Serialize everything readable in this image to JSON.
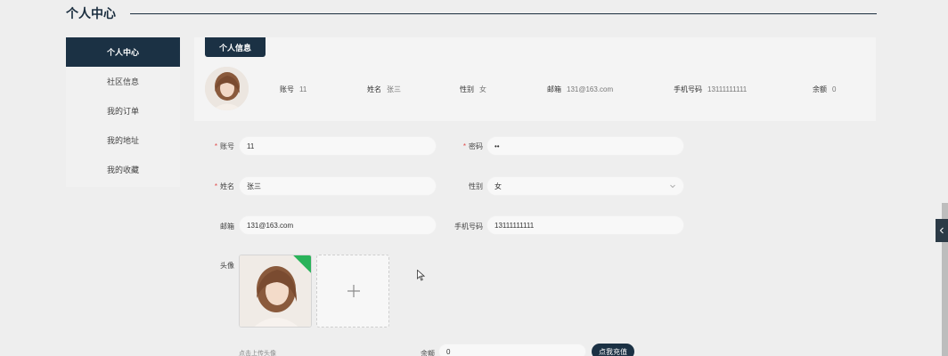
{
  "header": {
    "title": "个人中心"
  },
  "sidebar": {
    "items": [
      {
        "label": "个人中心"
      },
      {
        "label": "社区信息"
      },
      {
        "label": "我的订单"
      },
      {
        "label": "我的地址"
      },
      {
        "label": "我的收藏"
      }
    ]
  },
  "info_card": {
    "tab_label": "个人信息",
    "fields": [
      {
        "label": "账号",
        "value": "11"
      },
      {
        "label": "姓名",
        "value": "张三"
      },
      {
        "label": "性别",
        "value": "女"
      },
      {
        "label": "邮箱",
        "value": "131@163.com"
      },
      {
        "label": "手机号码",
        "value": "13111111111"
      },
      {
        "label": "余额",
        "value": "0"
      }
    ]
  },
  "form": {
    "account": {
      "label": "账号",
      "value": "11"
    },
    "password": {
      "label": "密码",
      "value": "••"
    },
    "name": {
      "label": "姓名",
      "value": "张三"
    },
    "gender": {
      "label": "性别",
      "value": "女"
    },
    "email": {
      "label": "邮箱",
      "value": "131@163.com"
    },
    "phone": {
      "label": "手机号码",
      "value": "13111111111"
    },
    "avatar": {
      "label": "头像",
      "hint": "点击上传头像"
    },
    "balance": {
      "label": "余额",
      "value": "0"
    },
    "recharge_label": "点我充值"
  },
  "colors": {
    "primary": "#1b3144",
    "success": "#29b35a",
    "required": "#e04b4b"
  }
}
